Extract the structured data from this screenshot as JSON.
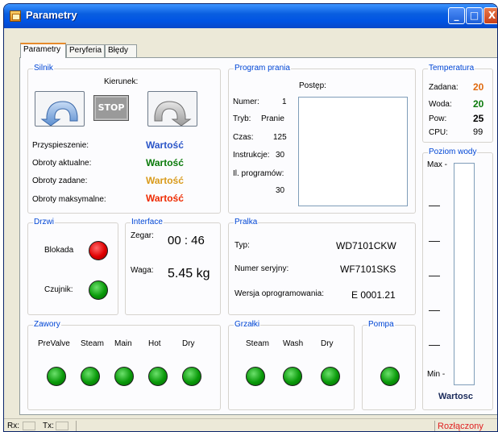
{
  "window": {
    "title": "Parametry"
  },
  "titlebar_buttons": {
    "minimize": "_",
    "maximize": "□",
    "close": "X"
  },
  "tabs": [
    {
      "label": "Parametry"
    },
    {
      "label": "Peryferia"
    },
    {
      "label": "Błędy"
    }
  ],
  "silnik": {
    "title": "Silnik",
    "direction_label": "Kierunek:",
    "stop_label": "STOP",
    "rows": [
      {
        "label": "Przyspieszenie:",
        "value": "Wartość",
        "color": "#2a55c8"
      },
      {
        "label": "Obroty aktualne:",
        "value": "Wartość",
        "color": "#0a7a0a"
      },
      {
        "label": "Obroty zadane:",
        "value": "Wartość",
        "color": "#d99a1a"
      },
      {
        "label": "Obroty maksymalne:",
        "value": "Wartość",
        "color": "#ee2a00"
      }
    ]
  },
  "program": {
    "title": "Program prania",
    "numer_label": "Numer:",
    "numer_value": "1",
    "tryb_label": "Tryb:",
    "tryb_value": "Pranie",
    "czas_label": "Czas:",
    "czas_value": "125",
    "instrukcje_label": "Instrukcje:",
    "instrukcje_value": "30",
    "programow_label": "Il. programów:",
    "programow_value": "30",
    "postep_label": "Postęp:"
  },
  "temperatura": {
    "title": "Temperatura",
    "rows": [
      {
        "label": "Zadana:",
        "value": "20",
        "color": "#e06a10"
      },
      {
        "label": "Woda:",
        "value": "20",
        "color": "#0a7a0a"
      },
      {
        "label": "Pow:",
        "value": "25",
        "color": "#000000"
      },
      {
        "label": "CPU:",
        "value": "99",
        "color": "#000000"
      }
    ]
  },
  "poziom": {
    "title": "Poziom wody",
    "max_label": "Max -",
    "min_label": "Min -",
    "value": "Wartosc"
  },
  "drzwi": {
    "title": "Drzwi",
    "blokada_label": "Blokada",
    "czujnik_label": "Czujnik:",
    "blokada_color": "red",
    "czujnik_color": "green"
  },
  "interface": {
    "title": "Interface",
    "zegar_label": "Zegar:",
    "zegar_value": "00 : 46",
    "waga_label": "Waga:",
    "waga_value": "5.45 kg"
  },
  "pralka": {
    "title": "Pralka",
    "typ_label": "Typ:",
    "typ_value": "WD7101CKW",
    "serial_label": "Numer seryjny:",
    "serial_value": "WF7101SKS",
    "firmware_label": "Wersja oprogramowania:",
    "firmware_value": "E 0001.21"
  },
  "zawory": {
    "title": "Zawory",
    "items": [
      "PreValve",
      "Steam",
      "Main",
      "Hot",
      "Dry"
    ]
  },
  "grzalki": {
    "title": "Grzałki",
    "items": [
      "Steam",
      "Wash",
      "Dry"
    ]
  },
  "pompa": {
    "title": "Pompa"
  },
  "status": {
    "rx_label": "Rx:",
    "tx_label": "Tx:",
    "connection": "Rozłączony",
    "connection_color": "#e02020"
  }
}
